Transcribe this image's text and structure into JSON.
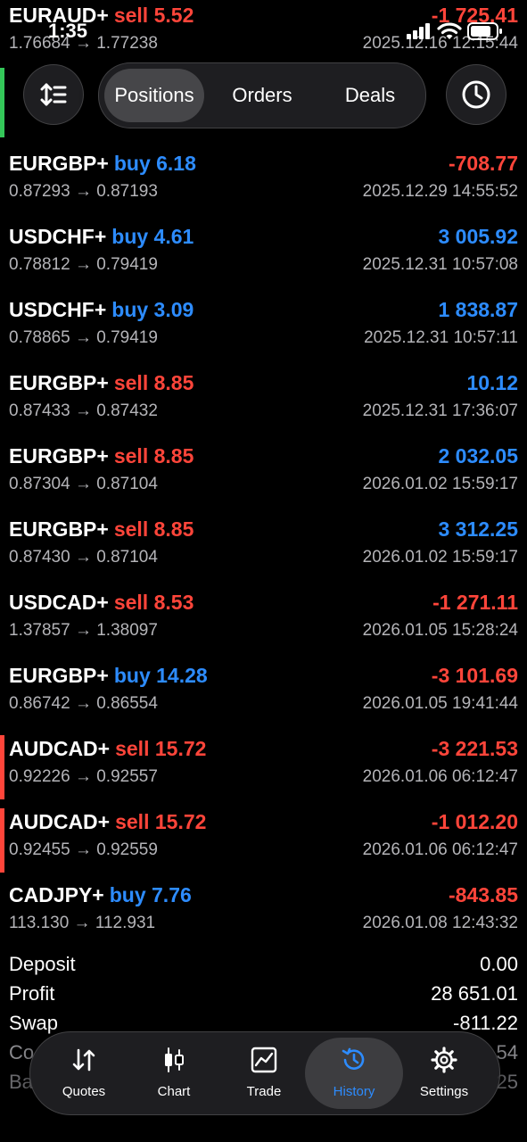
{
  "status": {
    "time": "1:35"
  },
  "top_nav": {
    "segments": [
      {
        "label": "Positions",
        "active": true
      },
      {
        "label": "Orders",
        "active": false
      },
      {
        "label": "Deals",
        "active": false
      }
    ]
  },
  "trades": [
    {
      "symbol": "EURAUD+",
      "side": "sell",
      "volume": "5.52",
      "prices": "1.76684 → 1.77238",
      "pnl": "-1 725.41",
      "date": "2025.12.16 12:15:44",
      "marker": ""
    },
    {
      "symbol": "EURGBP+",
      "side": "buy",
      "volume": "6.18",
      "prices": "0.87293 → 0.87193",
      "pnl": "-708.77",
      "date": "2025.12.29 14:55:52",
      "marker": ""
    },
    {
      "symbol": "USDCHF+",
      "side": "buy",
      "volume": "4.61",
      "prices": "0.78812 → 0.79419",
      "pnl": "3 005.92",
      "date": "2025.12.31 10:57:08",
      "marker": ""
    },
    {
      "symbol": "USDCHF+",
      "side": "buy",
      "volume": "3.09",
      "prices": "0.78865 → 0.79419",
      "pnl": "1 838.87",
      "date": "2025.12.31 10:57:11",
      "marker": ""
    },
    {
      "symbol": "EURGBP+",
      "side": "sell",
      "volume": "8.85",
      "prices": "0.87433 → 0.87432",
      "pnl": "10.12",
      "date": "2025.12.31 17:36:07",
      "marker": ""
    },
    {
      "symbol": "EURGBP+",
      "side": "sell",
      "volume": "8.85",
      "prices": "0.87304 → 0.87104",
      "pnl": "2 032.05",
      "date": "2026.01.02 15:59:17",
      "marker": ""
    },
    {
      "symbol": "EURGBP+",
      "side": "sell",
      "volume": "8.85",
      "prices": "0.87430 → 0.87104",
      "pnl": "3 312.25",
      "date": "2026.01.02 15:59:17",
      "marker": ""
    },
    {
      "symbol": "USDCAD+",
      "side": "sell",
      "volume": "8.53",
      "prices": "1.37857 → 1.38097",
      "pnl": "-1 271.11",
      "date": "2026.01.05 15:28:24",
      "marker": ""
    },
    {
      "symbol": "EURGBP+",
      "side": "buy",
      "volume": "14.28",
      "prices": "0.86742 → 0.86554",
      "pnl": "-3 101.69",
      "date": "2026.01.05 19:41:44",
      "marker": ""
    },
    {
      "symbol": "AUDCAD+",
      "side": "sell",
      "volume": "15.72",
      "prices": "0.92226 → 0.92557",
      "pnl": "-3 221.53",
      "date": "2026.01.06 06:12:47",
      "marker": "#ff453a"
    },
    {
      "symbol": "AUDCAD+",
      "side": "sell",
      "volume": "15.72",
      "prices": "0.92455 → 0.92559",
      "pnl": "-1 012.20",
      "date": "2026.01.06 06:12:47",
      "marker": "#ff453a"
    },
    {
      "symbol": "CADJPY+",
      "side": "buy",
      "volume": "7.76",
      "prices": "113.130 → 112.931",
      "pnl": "-843.85",
      "date": "2026.01.08 12:43:32",
      "marker": ""
    }
  ],
  "summary": [
    {
      "label": "Deposit",
      "value": "0.00"
    },
    {
      "label": "Profit",
      "value": "28 651.01"
    },
    {
      "label": "Swap",
      "value": "-811.22"
    },
    {
      "label": "Co",
      "value": "54"
    },
    {
      "label": "Ba",
      "value": "25"
    }
  ],
  "tabs": [
    {
      "label": "Quotes",
      "icon": "quotes-icon",
      "active": false
    },
    {
      "label": "Chart",
      "icon": "chart-icon",
      "active": false
    },
    {
      "label": "Trade",
      "icon": "trade-icon",
      "active": false
    },
    {
      "label": "History",
      "icon": "history-icon",
      "active": true
    },
    {
      "label": "Settings",
      "icon": "settings-icon",
      "active": false
    }
  ],
  "colors": {
    "buy": "#2d8cff",
    "sell": "#ff453a",
    "profit": "#2d8cff",
    "loss": "#ff453a",
    "accent": "#2d8cff",
    "second_row_marker": "#34c759"
  }
}
